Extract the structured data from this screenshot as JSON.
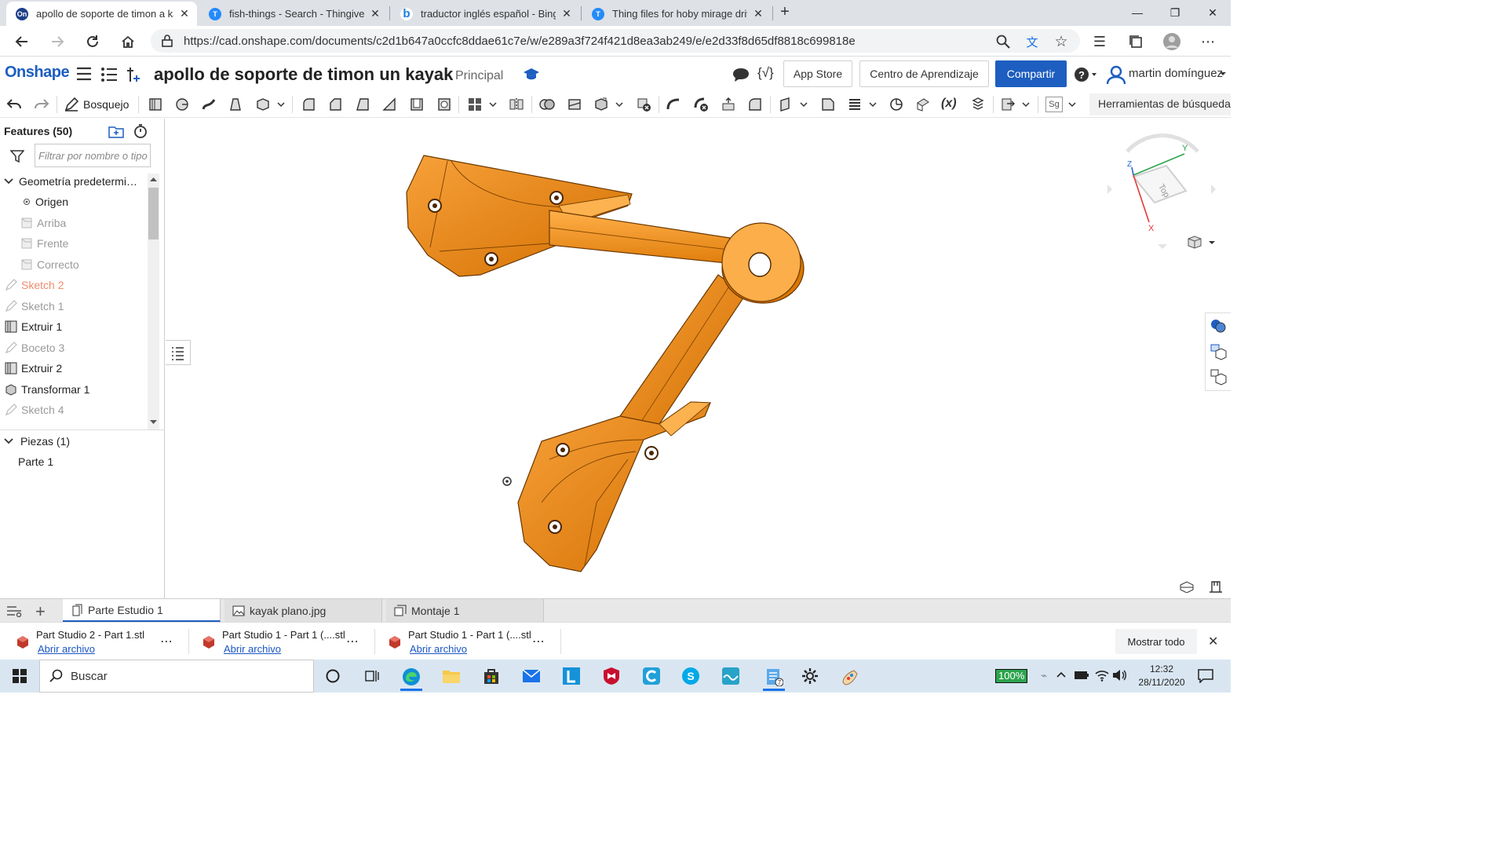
{
  "browser": {
    "tabs": [
      {
        "title": "apollo de soporte de timon a kay",
        "icon": "onshape-favicon",
        "active": true
      },
      {
        "title": "fish-things - Search - Thingiverse",
        "icon": "thingiverse-favicon",
        "active": false
      },
      {
        "title": "traductor inglés español - Bing",
        "icon": "bing-favicon",
        "active": false
      },
      {
        "title": "Thing files for hoby mirage drive",
        "icon": "thingiverse-favicon",
        "active": false
      }
    ],
    "new_tab": "+",
    "url": "https://cad.onshape.com/documents/c2d1b647a0ccfc8ddae61c7e/w/e289a3f724f421d8ea3ab249/e/e2d33f8d65df8818c699818e"
  },
  "onshape": {
    "logo": "Onshape",
    "document_title": "apollo de soporte de timon un kayak",
    "branch": "Principal",
    "app_store": "App Store",
    "learning_center": "Centro de Aprendizaje",
    "share": "Compartir",
    "user_name": "martin domínguez",
    "sketch_button": "Bosquejo",
    "search_tools": "Herramientas de búsqueda",
    "accent_color": "#1d5ec0"
  },
  "features": {
    "title": "Features (50)",
    "filter_placeholder": "Filtrar por nombre o tipo",
    "default_geometry": "Geometría predeterminada",
    "items": [
      {
        "label": "Origen",
        "state": "normal",
        "icon": "origin-icon"
      },
      {
        "label": "Arriba",
        "state": "dim",
        "icon": "plane-icon"
      },
      {
        "label": "Frente",
        "state": "dim",
        "icon": "plane-icon"
      },
      {
        "label": "Correcto",
        "state": "dim",
        "icon": "plane-icon"
      },
      {
        "label": "Sketch 2",
        "state": "highlight",
        "icon": "sketch-icon"
      },
      {
        "label": "Sketch 1",
        "state": "dim",
        "icon": "sketch-icon"
      },
      {
        "label": "Extruir 1",
        "state": "normal",
        "icon": "extrude-icon"
      },
      {
        "label": "Boceto 3",
        "state": "dim",
        "icon": "sketch-icon"
      },
      {
        "label": "Extruir 2",
        "state": "normal",
        "icon": "extrude-icon"
      },
      {
        "label": "Transformar 1",
        "state": "normal",
        "icon": "transform-icon"
      },
      {
        "label": "Sketch 4",
        "state": "dim",
        "icon": "sketch-icon"
      }
    ],
    "parts_header": "Piezas (1)",
    "parts": [
      "Parte 1"
    ]
  },
  "viewcube": {
    "face": "Top",
    "axis_x": "X",
    "axis_y": "Y",
    "axis_z": "Z"
  },
  "bottom_tabs": [
    {
      "label": "Parte Estudio 1",
      "icon": "part-studio-icon",
      "active": true
    },
    {
      "label": "kayak plano.jpg",
      "icon": "image-icon",
      "active": false
    },
    {
      "label": "Montaje 1",
      "icon": "assembly-icon",
      "active": false
    }
  ],
  "downloads": {
    "items": [
      {
        "name": "Part Studio 2 - Part 1.stl",
        "action": "Abrir archivo"
      },
      {
        "name": "Part Studio 1 - Part 1 (....stl",
        "action": "Abrir archivo"
      },
      {
        "name": "Part Studio 1 - Part 1 (....stl",
        "action": "Abrir archivo"
      }
    ],
    "show_all": "Mostrar todo"
  },
  "taskbar": {
    "search_placeholder": "Buscar",
    "battery": "100%",
    "time": "12:32",
    "date": "28/11/2020"
  },
  "model_color": "#e8870e"
}
